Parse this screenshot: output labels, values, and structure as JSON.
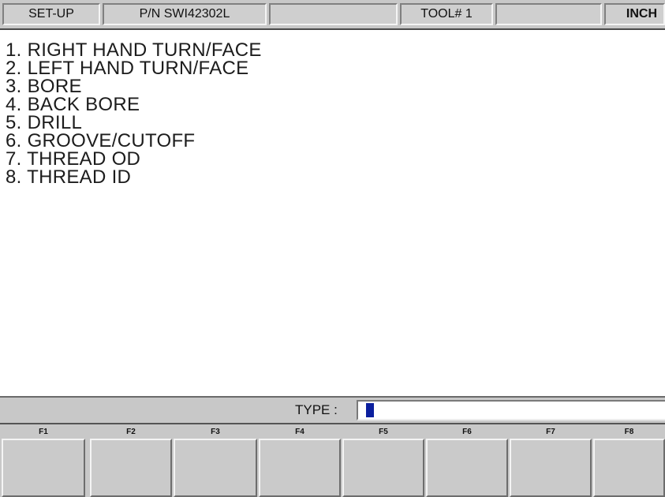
{
  "header": {
    "mode": "SET-UP",
    "part_number": "P/N SWI42302L",
    "blank1": "",
    "tool": "TOOL# 1",
    "blank2": "",
    "units": "INCH"
  },
  "menu": {
    "items": [
      "1. RIGHT HAND TURN/FACE",
      "2. LEFT HAND TURN/FACE",
      "3. BORE",
      "4. BACK BORE",
      "5. DRILL",
      "6. GROOVE/CUTOFF",
      "7. THREAD OD",
      "8. THREAD ID"
    ]
  },
  "prompt": {
    "label": "TYPE :",
    "value": ""
  },
  "fkeys": {
    "labels": [
      "F1",
      "F2",
      "F3",
      "F4",
      "F5",
      "F6",
      "F7",
      "F8"
    ],
    "captions": [
      "",
      "",
      "",
      "",
      "",
      "",
      "",
      ""
    ]
  },
  "colors": {
    "cursor": "#0b1f9e",
    "panel": "#c8c8c8"
  }
}
